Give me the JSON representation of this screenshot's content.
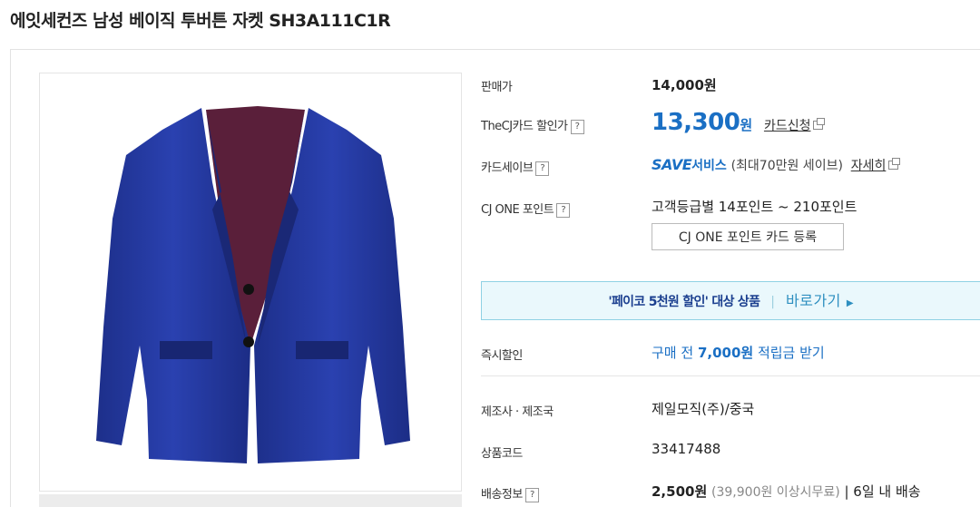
{
  "product": {
    "title": "에잇세컨즈 남성 베이직 투버튼 자켓 SH3A111C1R"
  },
  "info": {
    "price_label": "판매가",
    "price_value": "14,000원",
    "cj_label": "TheCJ카드 할인가",
    "cj_price": "13,300",
    "cj_won": "원",
    "cj_link": "카드신청",
    "cardsave_label": "카드세이브",
    "save_logo": "SAVE",
    "save_service": "서비스",
    "save_desc": "(최대70만원 세이브)",
    "save_link": "자세히",
    "cjone_label": "CJ ONE 포인트",
    "cjone_value": "고객등급별 14포인트 ~ 210포인트",
    "cjone_button": "CJ ONE 포인트 카드 등록",
    "help_mark": "?",
    "payco_text": "'페이코 5천원 할인' 대상 상품",
    "payco_sep": "|",
    "payco_go": "바로가기",
    "payco_arrow": "▶",
    "instant_label": "즉시할인",
    "instant_pre": "구매 전 ",
    "instant_amount": "7,000원",
    "instant_post": " 적립금 받기",
    "maker_label": "제조사 · 제조국",
    "maker_value": "제일모직(주)/중국",
    "code_label": "상품코드",
    "code_value": "33417488",
    "ship_label": "배송정보",
    "ship_price": "2,500원",
    "ship_free": "(39,900원 이상시무료)",
    "ship_days": "| 6일 내 배송"
  }
}
